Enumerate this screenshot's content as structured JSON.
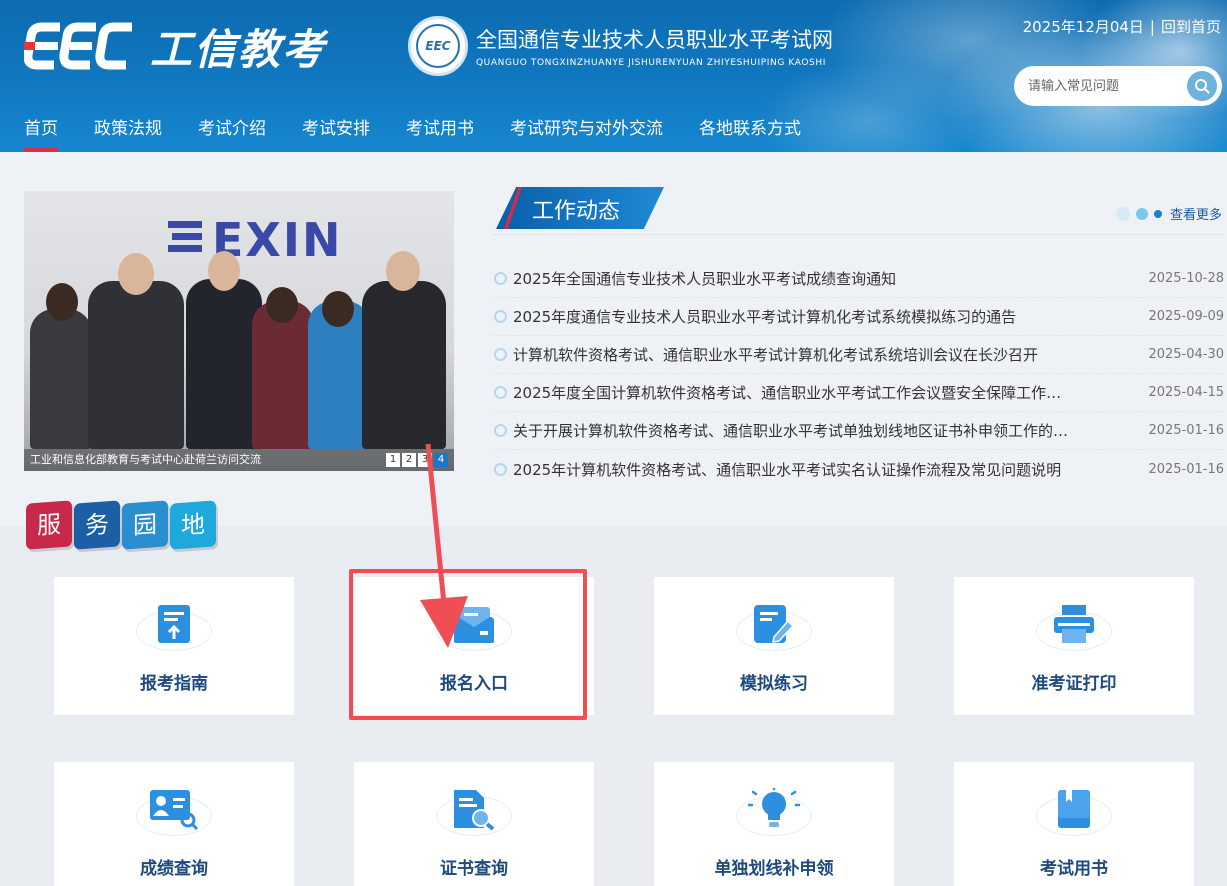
{
  "brand": {
    "logo_text": "EEC",
    "title": "工信教考"
  },
  "site": {
    "seal_text": "EEC",
    "title_cn": "全国通信专业技术人员职业水平考试网",
    "title_en": "QUANGUO TONGXINZHUANYE JISHURENYUAN ZHIYESHUIPING KAOSHI"
  },
  "top": {
    "date": "2025年12月04日",
    "separator": "|",
    "home_link": "回到首页"
  },
  "search": {
    "placeholder": "请输入常见问题",
    "icon": "search-icon"
  },
  "nav": {
    "items": [
      {
        "label": "首页",
        "active": true
      },
      {
        "label": "政策法规"
      },
      {
        "label": "考试介绍"
      },
      {
        "label": "考试安排"
      },
      {
        "label": "考试用书"
      },
      {
        "label": "考试研究与对外交流"
      },
      {
        "label": "各地联系方式"
      }
    ]
  },
  "slideshow": {
    "brand_sign": "EXIN",
    "caption": "工业和信息化部教育与考试中心赴荷兰访问交流",
    "pages": [
      "1",
      "2",
      "3",
      "4"
    ],
    "active_page": "4"
  },
  "news": {
    "title": "工作动态",
    "more": "查看更多",
    "items": [
      {
        "title": "2025年全国通信专业技术人员职业水平考试成绩查询通知",
        "date": "2025-10-28"
      },
      {
        "title": "2025年度通信专业技术人员职业水平考试计算机化考试系统模拟练习的通告",
        "date": "2025-09-09"
      },
      {
        "title": "计算机软件资格考试、通信职业水平考试计算机化考试系统培训会议在长沙召开",
        "date": "2025-04-30"
      },
      {
        "title": "2025年度全国计算机软件资格考试、通信职业水平考试工作会议暨安全保障工作…",
        "date": "2025-04-15"
      },
      {
        "title": "关于开展计算机软件资格考试、通信职业水平考试单独划线地区证书补申领工作的…",
        "date": "2025-01-16"
      },
      {
        "title": "2025年计算机软件资格考试、通信职业水平考试实名认证操作流程及常见问题说明",
        "date": "2025-01-16"
      }
    ]
  },
  "services": {
    "title_chars": [
      "服",
      "务",
      "园",
      "地"
    ],
    "title_colors": [
      "#c8284a",
      "#1c5fa6",
      "#2b8ed0",
      "#1fa8dc"
    ],
    "items": [
      {
        "label": "报考指南",
        "icon": "guide-upload-icon"
      },
      {
        "label": "报名入口",
        "icon": "envelope-icon"
      },
      {
        "label": "模拟练习",
        "icon": "edit-document-icon"
      },
      {
        "label": "准考证打印",
        "icon": "printer-icon"
      },
      {
        "label": "成绩查询",
        "icon": "id-card-search-icon"
      },
      {
        "label": "证书查询",
        "icon": "document-search-icon"
      },
      {
        "label": "单独划线补申领",
        "icon": "lightbulb-icon"
      },
      {
        "label": "考试用书",
        "icon": "book-icon"
      }
    ]
  },
  "colors": {
    "primary": "#117ac3",
    "accent_red": "#d9304a",
    "card_title": "#1f4a7e",
    "highlight": "#ef4f54"
  }
}
